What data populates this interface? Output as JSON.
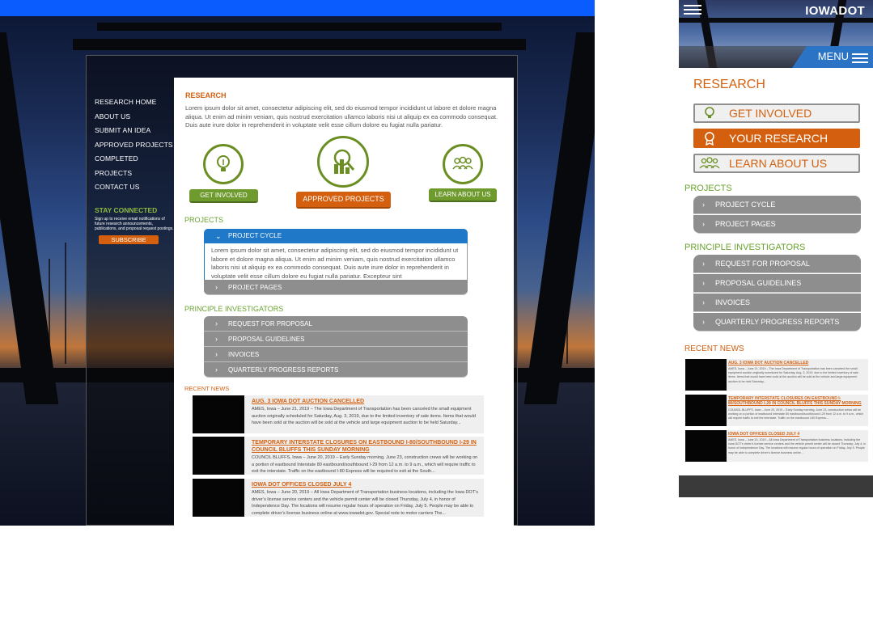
{
  "desktop": {
    "side_nav": {
      "items": [
        "RESEARCH HOME",
        "ABOUT US",
        "SUBMIT AN IDEA",
        "APPROVED PROJECTS",
        "COMPLETED PROJECTS",
        "CONTACT US"
      ],
      "stay_connected_title": "STAY CONNECTED",
      "stay_connected_text": "Sign up to receive email notifications of future research announcements, publications, and proposal request postings.",
      "subscribe_label": "SUBSCRIBE"
    },
    "research_title": "RESEARCH",
    "intro": "Lorem ipsum dolor sit amet, consectetur adipiscing elit, sed do eiusmod tempor incididunt ut labore et dolore magna aliqua. Ut enim ad minim veniam, quis nostrud exercitation ullamco laboris nisi ut aliquip ex ea commodo consequat. Duis aute irure dolor in reprehenderit in voluptate velit esse cillum dolore eu fugiat nulla pariatur.",
    "cta": {
      "get_involved": "GET INVOLVED",
      "approved_projects": "APPROVED PROJECTS",
      "learn_about_us": "LEARN ABOUT US"
    },
    "projects_title": "PROJECTS",
    "project_cycle": "PROJECT CYCLE",
    "project_cycle_text": "Lorem ipsum dolor sit amet, consectetur adipiscing elit, sed do eiusmod tempor incididunt ut labore et dolore magna aliqua. Ut enim ad minim veniam, quis nostrud exercitation ullamco laboris nisi ut aliquip ex ea commodo consequat. Duis aute irure dolor in reprehenderit in voluptate velit esse cillum dolore eu fugiat nulla pariatur. Excepteur sint",
    "project_pages": "PROJECT PAGES",
    "pi_title": "PRINCIPLE INVESTIGATORS",
    "pi_items": [
      "REQUEST FOR PROPOSAL",
      "PROPOSAL GUIDELINES",
      "INVOICES",
      "QUARTERLY PROGRESS REPORTS"
    ],
    "recent_news_title": "RECENT NEWS",
    "news": [
      {
        "title": "AUG. 3 IOWA DOT AUCTION CANCELLED",
        "body": "AMES, Iowa – June 21, 2019 – The Iowa Department of Transportation has been canceled the small equipment auction originally scheduled for Saturday, Aug. 3, 2019, due to the limited inventory of sale items. Items that would have been sold at the auction will be sold at the vehicle and large equipment auction to be held Saturday..."
      },
      {
        "title": "TEMPORARY INTERSTATE CLOSURES ON EASTBOUND I-80/SOUTHBOUND I-29 IN COUNCIL BLUFFS THIS SUNDAY MORNING",
        "body": "COUNCIL BLUFFS, Iowa – June 20, 2019 – Early Sunday morning, June 23, construction crews will be working on a portion of eastbound Interstate 80 eastbound/southbound I-29 from 12 a.m. to 9 a.m., which will require traffic to exit the interstate. Traffic on the eastbound I-80 Express will be required to exit at the South..."
      },
      {
        "title": "IOWA DOT OFFICES CLOSED JULY 4",
        "body": "AMES, Iowa – June 20, 2019 – All Iowa Department of Transportation business locations, including the Iowa DOT’s driver’s license service centers and the vehicle permit center will be closed Thursday, July 4, in honor of Independence Day. The locations will resume regular hours of operation on Friday, July 5. People may be able to complete driver’s license business online at www.iowadot.gov. Special note to motor carriers The..."
      }
    ]
  },
  "mobile": {
    "brand": "IOWADOT",
    "menu_label": "MENU",
    "research_title": "RESEARCH",
    "cards": [
      "GET INVOLVED",
      "YOUR RESEARCH",
      "LEARN ABOUT US"
    ],
    "projects_title": "PROJECTS",
    "project_items": [
      "PROJECT CYCLE",
      "PROJECT PAGES"
    ],
    "pi_title": "PRINCIPLE INVESTIGATORS",
    "pi_items": [
      "REQUEST FOR PROPOSAL",
      "PROPOSAL GUIDELINES",
      "INVOICES",
      "QUARTERLY PROGRESS REPORTS"
    ],
    "recent_news_title": "RECENT NEWS",
    "news": [
      {
        "title": "AUG. 3 IOWA DOT AUCTION CANCELLED",
        "body": "AMES, Iowa – June 21, 2019 – The Iowa Department of Transportation has been canceled the small equipment auction originally scheduled for Saturday, Aug. 3, 2019, due to the limited inventory of sale items. Items that would have been sold at the auction will be sold at the vehicle and large equipment auction to be held Saturday..."
      },
      {
        "title": "TEMPORARY INTERSTATE CLOSURES ON EASTBOUND I-80/SOUTHBOUND I-29 IN COUNCIL BLUFFS THIS SUNDAY MORNING",
        "body": "COUNCIL BLUFFS, Iowa – June 20, 2019 – Early Sunday morning, June 23, construction crews will be working on a portion of eastbound Interstate 80 eastbound/southbound I-29 from 12 a.m. to 9 a.m., which will require traffic to exit the interstate. Traffic on the eastbound I-80 Express..."
      },
      {
        "title": "IOWA DOT OFFICES CLOSED JULY 4",
        "body": "AMES, Iowa – June 20, 2019 – All Iowa Department of Transportation business locations, including the Iowa DOT’s driver’s license service centers and the vehicle permit center will be closed Thursday, July 4, in honor of Independence Day. The locations will resume regular hours of operation on Friday, July 5. People may be able to complete driver’s license business online..."
      }
    ]
  },
  "colors": {
    "accent_orange": "#d4600f",
    "accent_green": "#6aa22f",
    "accordion_blue": "#1f78c8",
    "accordion_gray": "#8e8e8e",
    "top_bar_blue": "#0a5cff"
  }
}
